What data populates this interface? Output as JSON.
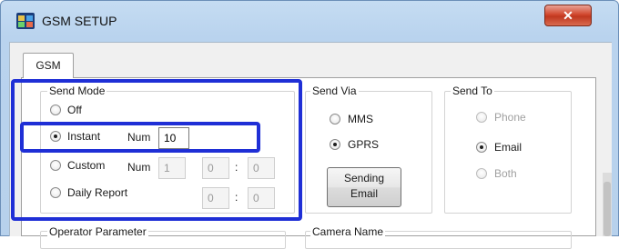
{
  "window": {
    "title": "GSM SETUP",
    "close_glyph": "✕"
  },
  "tabs": [
    {
      "label": "GSM",
      "selected": true
    }
  ],
  "send_mode": {
    "legend": "Send Mode",
    "off_label": "Off",
    "instant_label": "Instant",
    "custom_label": "Custom",
    "daily_label": "Daily Report",
    "selected": "Instant",
    "num_label": "Num",
    "instant_num": "10",
    "custom_num_label": "Num",
    "custom_num": "1",
    "custom_hour": "0",
    "custom_minute": "0",
    "daily_hour": "0",
    "daily_minute": "0",
    "colon": ":"
  },
  "send_via": {
    "legend": "Send Via",
    "mms_label": "MMS",
    "gprs_label": "GPRS",
    "selected": "GPRS",
    "button_line1": "Sending",
    "button_line2": "Email"
  },
  "send_to": {
    "legend": "Send To",
    "phone_label": "Phone",
    "email_label": "Email",
    "both_label": "Both",
    "selected": "Email"
  },
  "lower_groups": {
    "operator_label": "Operator Parameter",
    "camera_label": "Camera Name"
  },
  "colors": {
    "highlight": "#1f2fd6",
    "close_button": "#c9422c",
    "title_bar": "#b9d3ee"
  },
  "icons": {
    "app": "app-icon",
    "close": "close-icon"
  }
}
